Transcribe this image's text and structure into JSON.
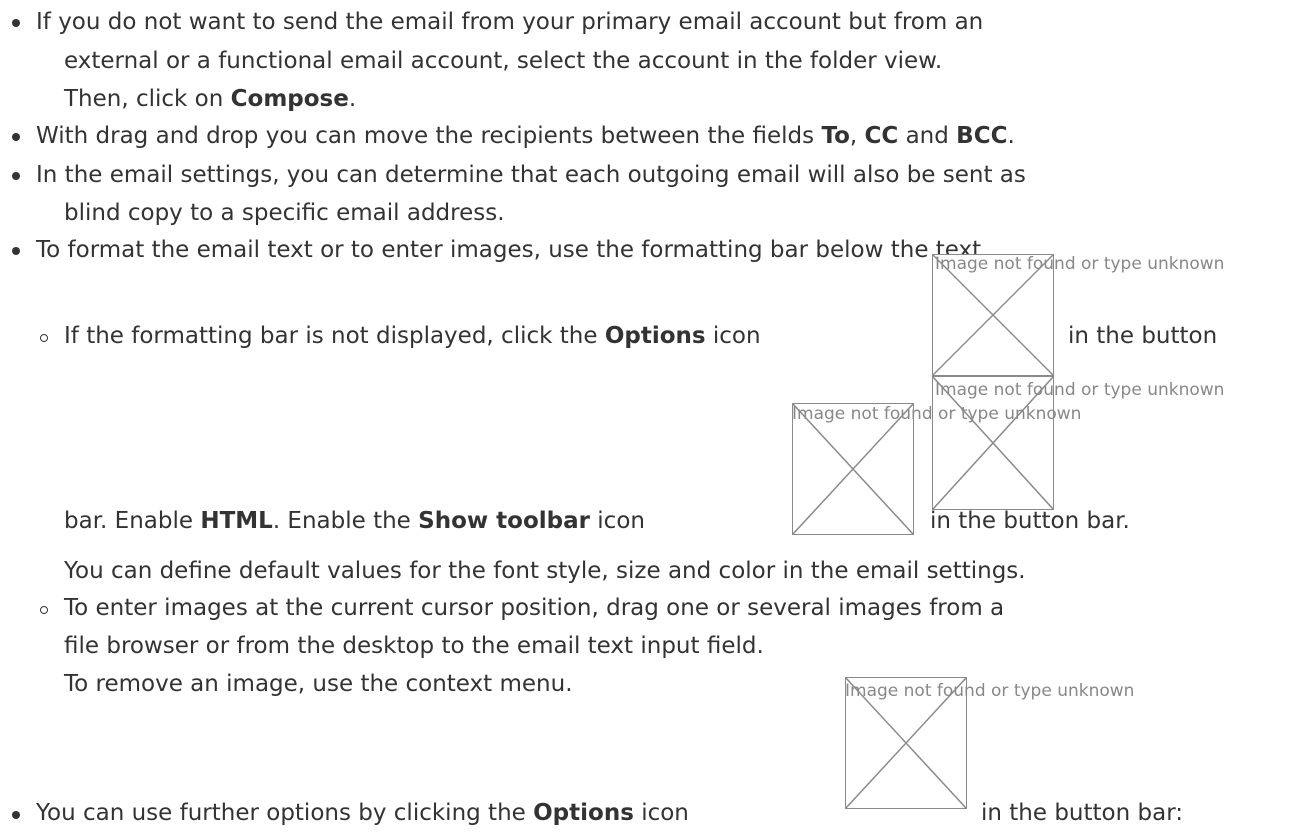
{
  "items": [
    {
      "lines": [
        "If you do not want to send the email from your primary email account but from an",
        "external or a functional email account, select the account in the folder view."
      ],
      "line3_prefix": "Then, click on ",
      "line3_bold": "Compose",
      "line3_suffix": "."
    },
    {
      "prefix": "With drag and drop you can move the recipients between the fields ",
      "to": "To",
      "sep1": ", ",
      "cc": "CC",
      "sep2": " and ",
      "bcc": "BCC",
      "suffix": "."
    },
    {
      "lines": [
        "In the email settings, you can determine that each outgoing email will also be sent as",
        "blind copy to a specific email address."
      ]
    },
    {
      "text": "To format the email text or to enter images, use the formatting bar below the text.",
      "subitems": [
        {
          "l1_prefix": "If the formatting bar is not displayed, click the ",
          "l1_bold": "Options",
          "l1_mid": " icon",
          "l1_after_icon": "in the button",
          "l2_prefix": "bar. Enable ",
          "l2_bold1": "HTML",
          "l2_mid": ". Enable the ",
          "l2_bold2": "Show toolbar",
          "l2_mid2": " icon",
          "l2_after_icon": "in the button bar.",
          "l3": "You can define default values for the font style, size and color in the email settings."
        },
        {
          "lines": [
            "To enter images at the current cursor position, drag one or several images from a",
            "file browser or from the desktop to the email text input field.",
            "To remove an image, use the context menu."
          ]
        }
      ]
    },
    {
      "prefix": "You can use further options by clicking the ",
      "bold": "Options",
      "mid": " icon",
      "after_icon": "in the button bar:"
    }
  ],
  "broken_image_caption": "Image not found or type unknown"
}
